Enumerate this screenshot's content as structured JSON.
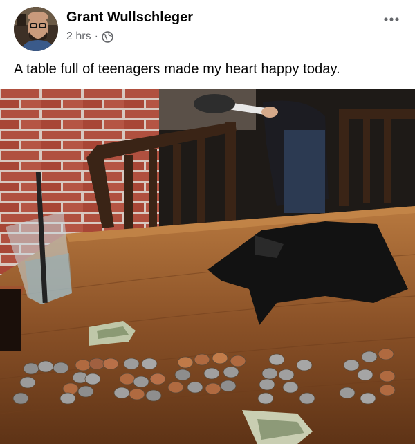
{
  "post": {
    "author_name": "Grant Wullschleger",
    "timestamp": "2 hrs",
    "separator": "·",
    "audience_icon": "globe-icon",
    "more_icon": "more-options-icon",
    "caption": "A table full of teenagers made my heart happy today."
  },
  "photo": {
    "description_icon": "photo"
  },
  "colors": {
    "text_primary": "#050505",
    "text_secondary": "#65676b",
    "background": "#ffffff"
  }
}
